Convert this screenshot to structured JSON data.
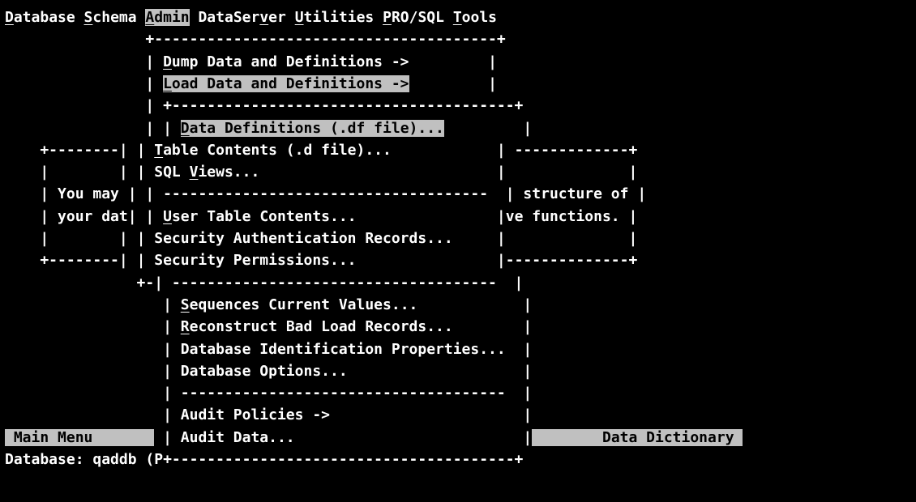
{
  "menubar": {
    "items": [
      {
        "pre": "",
        "hot": "D",
        "post": "atabase",
        "highlighted": false
      },
      {
        "pre": "",
        "hot": "S",
        "post": "chema",
        "highlighted": false
      },
      {
        "pre": "",
        "hot": "A",
        "post": "dmin",
        "highlighted": true
      },
      {
        "pre": "DataSer",
        "hot": "v",
        "post": "er",
        "highlighted": false
      },
      {
        "pre": "",
        "hot": "U",
        "post": "tilities",
        "highlighted": false
      },
      {
        "pre": "",
        "hot": "P",
        "post": "RO/SQL",
        "highlighted": false
      },
      {
        "pre": "",
        "hot": "T",
        "post": "ools",
        "highlighted": false
      }
    ]
  },
  "admin_menu": {
    "items": [
      {
        "hot": "D",
        "post": "ump Data and Definitions ->",
        "highlighted": false
      },
      {
        "hot": "L",
        "post": "oad Data and Definitions ->",
        "highlighted": true
      }
    ]
  },
  "load_submenu": {
    "items": [
      {
        "pre": "",
        "hot": "D",
        "post": "ata Definitions (.df file)...",
        "highlighted": true
      },
      {
        "pre": "",
        "hot": "T",
        "post": "able Contents (.d file)...",
        "highlighted": false
      },
      {
        "pre": "SQL ",
        "hot": "V",
        "post": "iews...",
        "highlighted": false
      },
      {
        "separator": true
      },
      {
        "pre": "",
        "hot": "U",
        "post": "ser Table Contents...",
        "highlighted": false
      },
      {
        "pre": "Security Authentication Records...",
        "hot": "",
        "post": "",
        "highlighted": false
      },
      {
        "pre": "Security Permissions...",
        "hot": "",
        "post": "",
        "highlighted": false
      },
      {
        "separator": true
      },
      {
        "pre": "",
        "hot": "S",
        "post": "equences Current Values...",
        "highlighted": false
      },
      {
        "pre": "",
        "hot": "R",
        "post": "econstruct Bad Load Records...",
        "highlighted": false
      },
      {
        "pre": "Database Identification Properties...",
        "hot": "",
        "post": "",
        "highlighted": false
      },
      {
        "pre": "Database Options...",
        "hot": "",
        "post": "",
        "highlighted": false
      },
      {
        "separator": true
      },
      {
        "pre": "Audit Policies ->",
        "hot": "",
        "post": "",
        "highlighted": false
      },
      {
        "pre": "Audit Data...",
        "hot": "",
        "post": "",
        "highlighted": false
      }
    ]
  },
  "background": {
    "left_panel_line1": " You may ",
    "left_panel_line2": " your dat",
    "right_panel_line1": " structure of ",
    "right_panel_line2": "ve functions. "
  },
  "status": {
    "main_menu_label": "Main Menu",
    "data_dictionary_label": "Data Dictionary",
    "database_line": "Database: qaddb (P"
  },
  "colors": {
    "background": "#000000",
    "foreground": "#ffffff",
    "highlight_bg": "#c0c0c0",
    "highlight_fg": "#000000"
  }
}
